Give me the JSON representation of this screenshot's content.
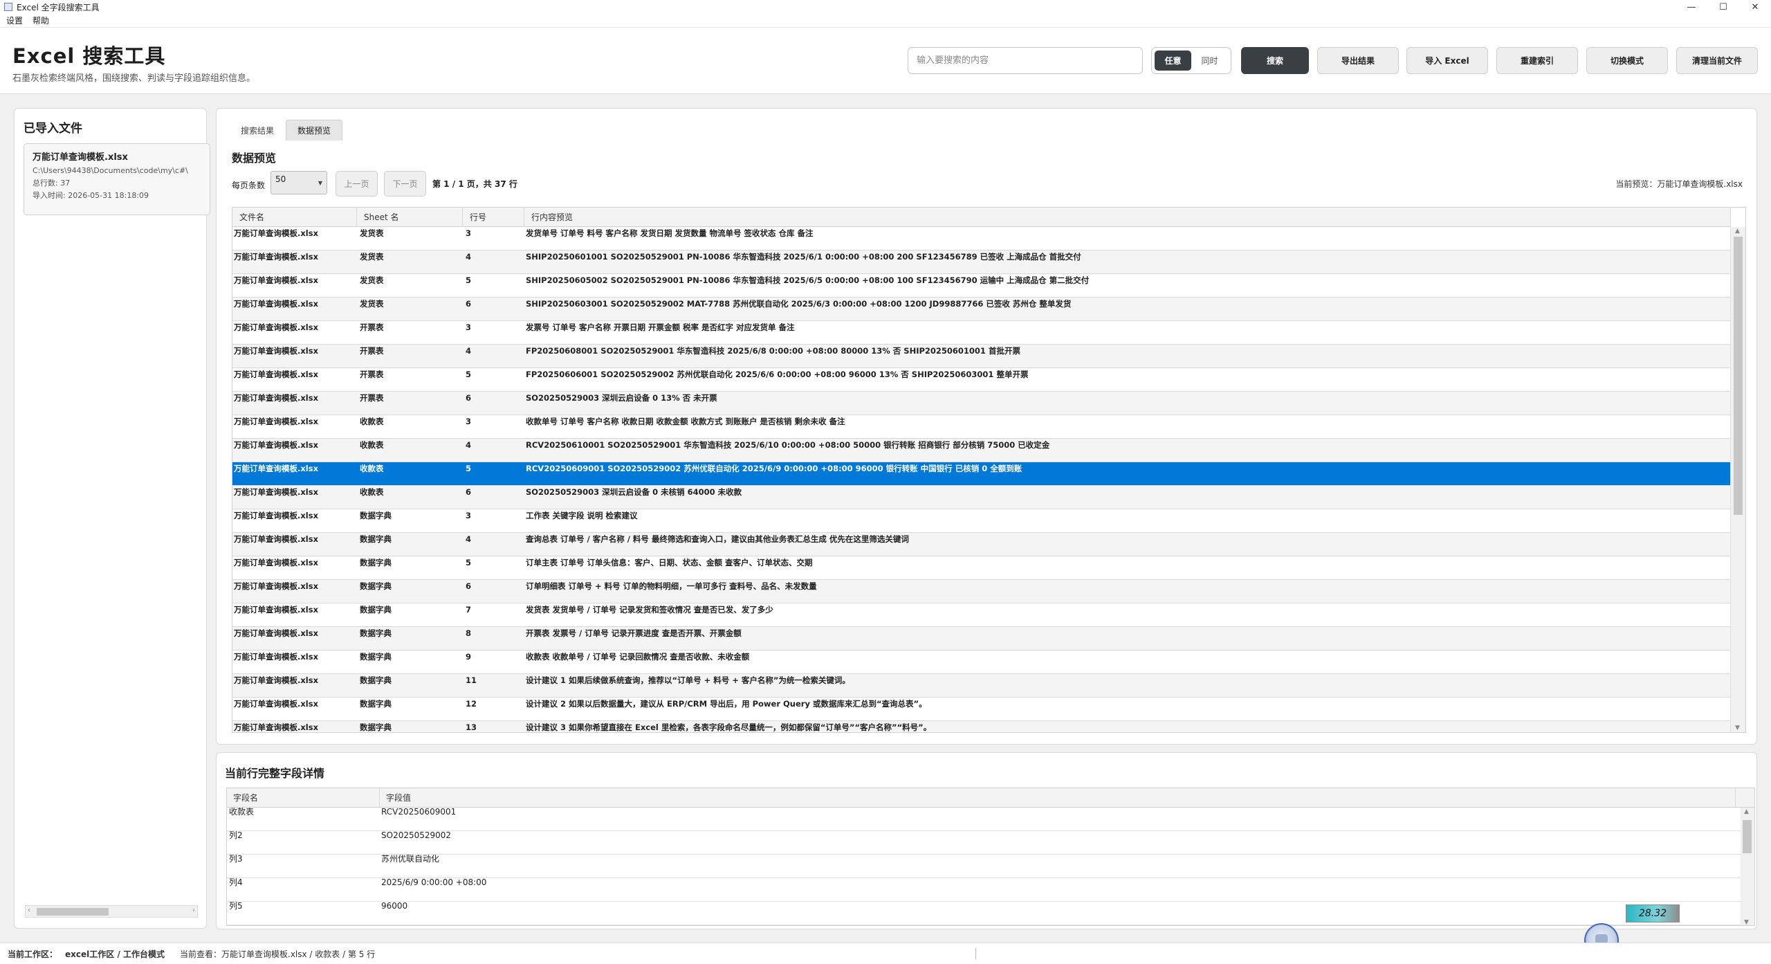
{
  "window": {
    "title": "Excel 全字段搜索工具"
  },
  "menu": [
    "设置",
    "帮助"
  ],
  "header": {
    "title": "Excel 搜索工具",
    "subtitle": "石墨灰检索终端风格，围绕搜索、判读与字段追踪组织信息。"
  },
  "search": {
    "placeholder": "输入要搜索的内容",
    "value": ""
  },
  "mode_toggle": {
    "options": [
      "任意",
      "同时"
    ],
    "active": "任意"
  },
  "toolbar": {
    "search_label": "搜索",
    "export_label": "导出结果",
    "import_label": "导入 Excel",
    "rebuild_label": "重建索引",
    "switch_label": "切换模式",
    "clear_label": "清理当前文件"
  },
  "sidebar": {
    "title": "已导入文件",
    "file": {
      "name": "万能订单查询模板.xlsx",
      "path": "C:\\Users\\94438\\Documents\\code\\my\\c#\\",
      "rows": "总行数: 37",
      "imported": "导入时间: 2026-05-31 18:18:09"
    }
  },
  "tabs": [
    "搜索结果",
    "数据预览"
  ],
  "active_tab": "数据预览",
  "preview": {
    "title": "数据预览",
    "per_page_label": "每页条数",
    "per_page_value": "50",
    "prev_label": "上一页",
    "next_label": "下一页",
    "page_info": "第 1 / 1 页，共 37 行",
    "current": "当前预览：万能订单查询模板.xlsx"
  },
  "grid": {
    "columns": [
      "文件名",
      "Sheet 名",
      "行号",
      "行内容预览"
    ],
    "selected_index": 10,
    "rows": [
      [
        "万能订单查询模板.xlsx",
        "发货表",
        "3",
        "发货单号 订单号 料号 客户名称 发货日期 发货数量 物流单号 签收状态 仓库 备注"
      ],
      [
        "万能订单查询模板.xlsx",
        "发货表",
        "4",
        "SHIP20250601001 SO20250529001 PN-10086 华东智造科技 2025/6/1 0:00:00 +08:00 200 SF123456789 已签收 上海成品仓 首批交付"
      ],
      [
        "万能订单查询模板.xlsx",
        "发货表",
        "5",
        "SHIP20250605002 SO20250529001 PN-10086 华东智造科技 2025/6/5 0:00:00 +08:00 100 SF123456790 运输中 上海成品仓 第二批交付"
      ],
      [
        "万能订单查询模板.xlsx",
        "发货表",
        "6",
        "SHIP20250603001 SO20250529002 MAT-7788 苏州优联自动化 2025/6/3 0:00:00 +08:00 1200 JD99887766 已签收 苏州仓 整单发货"
      ],
      [
        "万能订单查询模板.xlsx",
        "开票表",
        "3",
        "发票号 订单号 客户名称 开票日期 开票金额 税率 是否红字 对应发货单 备注"
      ],
      [
        "万能订单查询模板.xlsx",
        "开票表",
        "4",
        "FP20250608001 SO20250529001 华东智造科技 2025/6/8 0:00:00 +08:00 80000 13% 否 SHIP20250601001 首批开票"
      ],
      [
        "万能订单查询模板.xlsx",
        "开票表",
        "5",
        "FP20250606001 SO20250529002 苏州优联自动化 2025/6/6 0:00:00 +08:00 96000 13% 否 SHIP20250603001 整单开票"
      ],
      [
        "万能订单查询模板.xlsx",
        "开票表",
        "6",
        "SO20250529003 深圳云启设备 0 13% 否 未开票"
      ],
      [
        "万能订单查询模板.xlsx",
        "收款表",
        "3",
        "收款单号 订单号 客户名称 收款日期 收款金额 收款方式 到账账户 是否核销 剩余未收 备注"
      ],
      [
        "万能订单查询模板.xlsx",
        "收款表",
        "4",
        "RCV20250610001 SO20250529001 华东智造科技 2025/6/10 0:00:00 +08:00 50000 银行转账 招商银行 部分核销 75000 已收定金"
      ],
      [
        "万能订单查询模板.xlsx",
        "收款表",
        "5",
        "RCV20250609001 SO20250529002 苏州优联自动化 2025/6/9 0:00:00 +08:00 96000 银行转账 中国银行 已核销 0 全额到账"
      ],
      [
        "万能订单查询模板.xlsx",
        "收款表",
        "6",
        "SO20250529003 深圳云启设备 0 未核销 64000 未收款"
      ],
      [
        "万能订单查询模板.xlsx",
        "数据字典",
        "3",
        "工作表 关键字段 说明 检索建议"
      ],
      [
        "万能订单查询模板.xlsx",
        "数据字典",
        "4",
        "查询总表 订单号 / 客户名称 / 料号 最终筛选和查询入口，建议由其他业务表汇总生成 优先在这里筛选关键词"
      ],
      [
        "万能订单查询模板.xlsx",
        "数据字典",
        "5",
        "订单主表 订单号 订单头信息：客户、日期、状态、金额 查客户、订单状态、交期"
      ],
      [
        "万能订单查询模板.xlsx",
        "数据字典",
        "6",
        "订单明细表 订单号 + 料号 订单的物料明细，一单可多行 查料号、品名、未发数量"
      ],
      [
        "万能订单查询模板.xlsx",
        "数据字典",
        "7",
        "发货表 发货单号 / 订单号 记录发货和签收情况 查是否已发、发了多少"
      ],
      [
        "万能订单查询模板.xlsx",
        "数据字典",
        "8",
        "开票表 发票号 / 订单号 记录开票进度 查是否开票、开票金额"
      ],
      [
        "万能订单查询模板.xlsx",
        "数据字典",
        "9",
        "收款表 收款单号 / 订单号 记录回款情况 查是否收款、未收金额"
      ],
      [
        "万能订单查询模板.xlsx",
        "数据字典",
        "11",
        "设计建议 1 如果后续做系统查询，推荐以“订单号 + 料号 + 客户名称”为统一检索关键词。"
      ],
      [
        "万能订单查询模板.xlsx",
        "数据字典",
        "12",
        "设计建议 2 如果以后数据量大，建议从 ERP/CRM 导出后，用 Power Query 或数据库来汇总到“查询总表”。"
      ],
      [
        "万能订单查询模板.xlsx",
        "数据字典",
        "13",
        "设计建议 3 如果你希望直接在 Excel 里检索，各表字段命名尽量统一，例如都保留“订单号”“客户名称”“料号”。"
      ]
    ]
  },
  "detail": {
    "title": "当前行完整字段详情",
    "columns": [
      "字段名",
      "字段值"
    ],
    "rows": [
      [
        "收款表",
        "RCV20250609001"
      ],
      [
        "列2",
        "SO20250529002"
      ],
      [
        "列3",
        "苏州优联自动化"
      ],
      [
        "列4",
        "2025/6/9 0:00:00 +08:00"
      ],
      [
        "列5",
        "96000"
      ]
    ]
  },
  "status": {
    "workspace_label": "当前工作区：",
    "workspace_value": "excel工作区 / 工作台模式",
    "viewing": "当前查看：万能订单查询模板.xlsx / 收款表 / 第 5 行"
  },
  "widget": {
    "value": "28.32"
  },
  "colors": {
    "accent": "#3a3f44",
    "selection": "#0078d7"
  }
}
